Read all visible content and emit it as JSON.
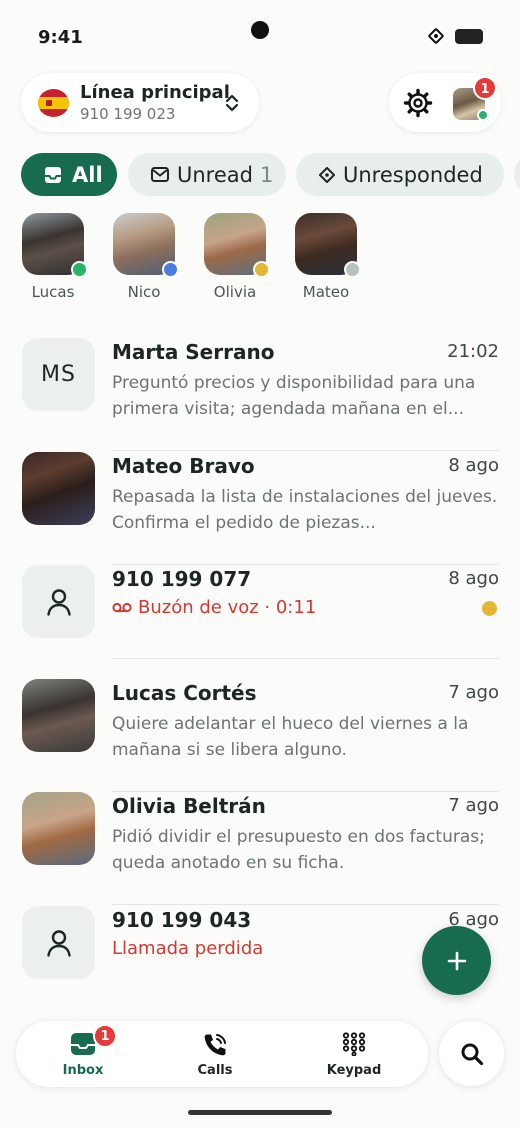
{
  "status_bar": {
    "time": "9:41"
  },
  "line_selector": {
    "title": "Línea principal",
    "number": "910 199 023"
  },
  "profile": {
    "badge_count": "1"
  },
  "filters": [
    {
      "label": "All",
      "count": ""
    },
    {
      "label": "Unread",
      "count": "1"
    },
    {
      "label": "Unresponded",
      "count": ""
    }
  ],
  "team": [
    {
      "name": "Lucas",
      "status_color": "#28b36a"
    },
    {
      "name": "Nico",
      "status_color": "#4a7be0"
    },
    {
      "name": "Olivia",
      "status_color": "#e5b634"
    },
    {
      "name": "Mateo",
      "status_color": "#b9c1bd"
    }
  ],
  "conversations": [
    {
      "title": "Marta Serrano",
      "initials": "MS",
      "time": "21:02",
      "snippet": "Preguntó precios y disponibilidad para una primera visita; agendada mañana en el..."
    },
    {
      "title": "Mateo Bravo",
      "time": "8 ago",
      "snippet": "Repasada la lista de instalaciones del jueves. Confirma el pedido de piezas..."
    },
    {
      "title": "910 199 077",
      "time": "8 ago",
      "status_text": "Buzón de voz · 0:11",
      "status_icon": "voicemail-icon"
    },
    {
      "title": "Lucas Cortés",
      "time": "7 ago",
      "snippet": "Quiere adelantar el hueco del viernes a la mañana si se libera alguno."
    },
    {
      "title": "Olivia Beltrán",
      "time": "7 ago",
      "snippet": "Pidió dividir el presupuesto en dos facturas; queda anotado en su ficha."
    },
    {
      "title": "910 199 043",
      "time": "6 ago",
      "status_text": "Llamada perdida"
    }
  ],
  "bottom_nav": {
    "items": [
      {
        "label": "Inbox",
        "icon": "inbox-icon",
        "badge": "1"
      },
      {
        "label": "Calls",
        "icon": "phone-icon"
      },
      {
        "label": "Keypad",
        "icon": "keypad-icon"
      }
    ]
  },
  "colors": {
    "accent": "#176b4f",
    "badge": "#e53a3a",
    "missed": "#d23a31"
  }
}
